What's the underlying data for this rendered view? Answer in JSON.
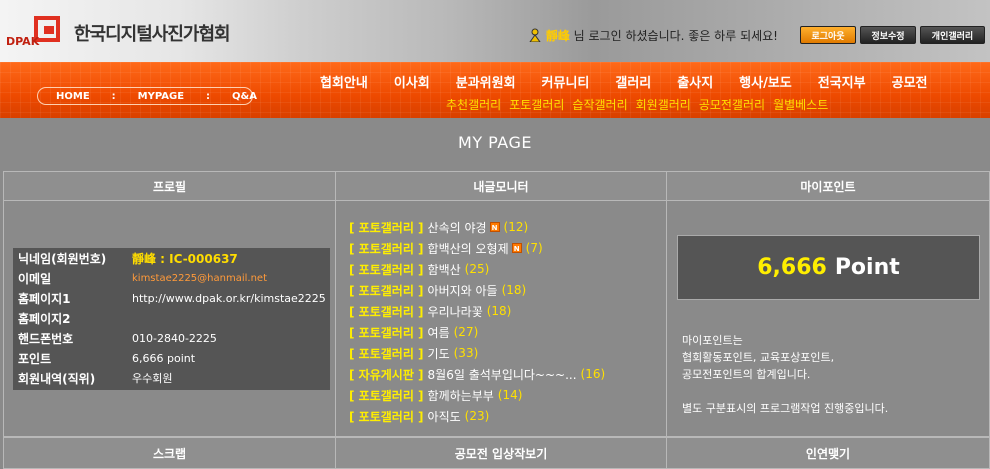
{
  "header": {
    "logo_text": "한국디지털사진가협회",
    "logo_abbr": "DPAK",
    "login": {
      "user": "靜峰",
      "message": " 님 로그인 하셨습니다. 좋은 하루 되세요!"
    },
    "buttons": {
      "logout": "로그아웃",
      "edit_profile": "정보수정",
      "personal_gallery": "개인갤러리"
    }
  },
  "nav": {
    "breadcrumb": [
      "HOME",
      ":",
      "MYPAGE",
      ":",
      "Q&A"
    ],
    "main_menu": [
      "협회안내",
      "이사회",
      "분과위원회",
      "커뮤니티",
      "갤러리",
      "출사지",
      "행사/보도",
      "전국지부",
      "공모전"
    ],
    "sub_menu": [
      "추천갤러리",
      "포토갤러리",
      "습작갤러리",
      "회원갤러리",
      "공모전갤러리",
      "월별베스트"
    ]
  },
  "page_title": "MY PAGE",
  "columns": {
    "profile": "프로필",
    "post_monitor": "내글모니터",
    "my_point": "마이포인트"
  },
  "profile": {
    "rows": [
      {
        "label": "닉네임(회원번호)",
        "value": "靜峰 : IC-000637"
      },
      {
        "label": "이메일",
        "value": "kimstae2225@hanmail.net"
      },
      {
        "label": "홈페이지1",
        "value": "http://www.dpak.or.kr/kimstae2225"
      },
      {
        "label": "홈페이지2",
        "value": ""
      },
      {
        "label": "핸드폰번호",
        "value": "010-2840-2225"
      },
      {
        "label": "포인트",
        "value": "6,666 point"
      },
      {
        "label": "회원내역(직위)",
        "value": "우수회원"
      }
    ]
  },
  "posts": [
    {
      "category": "[ 포토갤러리 ]",
      "title": "산속의 야경",
      "new": true,
      "count": "(12)"
    },
    {
      "category": "[ 포토갤러리 ]",
      "title": "합백산의 오형제",
      "new": true,
      "count": "(7)"
    },
    {
      "category": "[ 포토갤러리 ]",
      "title": "함백산",
      "new": false,
      "count": "(25)"
    },
    {
      "category": "[ 포토갤러리 ]",
      "title": "아버지와 아들",
      "new": false,
      "count": "(18)"
    },
    {
      "category": "[ 포토갤러리 ]",
      "title": "우리나라꽃",
      "new": false,
      "count": "(18)"
    },
    {
      "category": "[ 포토갤러리 ]",
      "title": "여름",
      "new": false,
      "count": "(27)"
    },
    {
      "category": "[ 포토갤러리 ]",
      "title": "기도",
      "new": false,
      "count": "(33)"
    },
    {
      "category": "[ 자유게시판 ]",
      "title": "8월6일 출석부입니다~~~...",
      "new": false,
      "count": "(16)"
    },
    {
      "category": "[ 포토갤러리 ]",
      "title": "함께하는부부",
      "new": false,
      "count": "(14)"
    },
    {
      "category": "[ 포토갤러리 ]",
      "title": "아직도",
      "new": false,
      "count": "(23)"
    }
  ],
  "new_badge": "N",
  "my_point": {
    "value": "6,666",
    "unit": "Point",
    "description": "마이포인트는\n협회활동포인트, 교육포상포인트,\n공모전포인트의 합계입니다.\n\n별도 구분표시의 프로그램작업 진행중입니다."
  },
  "footer_columns": {
    "scrap": "스크랩",
    "contest": "공모전 입상작보기",
    "relation": "인연맺기"
  },
  "colors": {
    "nav_orange": "#ee4a00",
    "highlight_yellow": "#ffee00",
    "panel_gray": "#8a8a8a"
  }
}
